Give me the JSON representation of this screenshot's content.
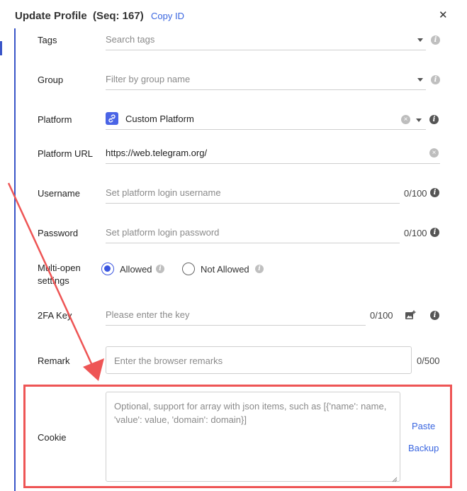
{
  "header": {
    "title": "Update Profile  (Seq: 167)",
    "copy_id": "Copy ID",
    "close_glyph": "✕"
  },
  "form": {
    "tags": {
      "label": "Tags",
      "placeholder": "Search tags"
    },
    "group": {
      "label": "Group",
      "placeholder": "Filter by group name"
    },
    "platform": {
      "label": "Platform",
      "value": "Custom Platform"
    },
    "platform_url": {
      "label": "Platform URL",
      "value": "https://web.telegram.org/"
    },
    "username": {
      "label": "Username",
      "placeholder": "Set platform login username",
      "counter": "0/100"
    },
    "password": {
      "label": "Password",
      "placeholder": "Set platform login password",
      "counter": "0/100"
    },
    "multi_open": {
      "label_line1": "Multi-open",
      "label_line2": "settings",
      "options": [
        {
          "label": "Allowed",
          "selected": true
        },
        {
          "label": "Not Allowed",
          "selected": false
        }
      ]
    },
    "twofa": {
      "label": "2FA Key",
      "placeholder": "Please enter the key",
      "counter": "0/100"
    },
    "remark": {
      "label": "Remark",
      "placeholder": "Enter the browser remarks",
      "counter": "0/500"
    },
    "cookie": {
      "label": "Cookie",
      "placeholder_line1": "Optional, support for array with json items, such as [{'name': name,",
      "placeholder_line2": "'value': value, 'domain': domain}]",
      "paste": "Paste",
      "backup": "Backup"
    }
  },
  "icons": {
    "info": "i",
    "clear": "×"
  },
  "colors": {
    "accent": "#3a55e0",
    "link": "#3a66e0",
    "annotation": "#ee5555"
  }
}
